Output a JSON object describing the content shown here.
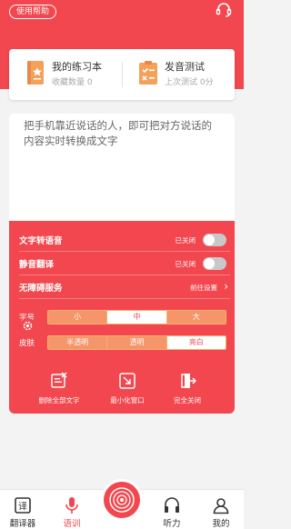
{
  "header": {
    "help_label": "使用帮助",
    "help_icon": "headset-icon"
  },
  "practice": {
    "notebook": {
      "title": "我的练习本",
      "subtitle": "收藏数量 0",
      "icon": "notebook-icon"
    },
    "test": {
      "title": "发音测试",
      "subtitle": "上次测试 0分",
      "icon": "checklist-icon"
    }
  },
  "input": {
    "hint": "把手机靠近说话的人，即可把对方说话的内容实时转换成文字"
  },
  "controls": {
    "tts": {
      "label": "文字转语音",
      "status": "已关闭",
      "on": false
    },
    "mute": {
      "label": "静音翻译",
      "status": "已关闭",
      "on": false
    },
    "accessibility": {
      "label": "无障碍服务",
      "link": "前往设置"
    },
    "font_size": {
      "label": "字号",
      "options": [
        "小",
        "中",
        "大"
      ],
      "selected": 1
    },
    "skin": {
      "label": "皮肤",
      "options": [
        "半透明",
        "透明",
        "亮白"
      ],
      "selected": 2
    },
    "actions": [
      {
        "label": "删除全部文字",
        "icon": "delete-text-icon"
      },
      {
        "label": "最小化窗口",
        "icon": "minimize-icon"
      },
      {
        "label": "完全关闭",
        "icon": "exit-icon"
      }
    ]
  },
  "colors": {
    "accent": "#f2474e",
    "segment": "#f4956a"
  },
  "nav": {
    "items": [
      {
        "label": "翻译器",
        "icon": "translator-icon"
      },
      {
        "label": "语训",
        "icon": "microphone-icon"
      },
      {
        "label": "听力",
        "icon": "headphones-icon"
      },
      {
        "label": "我的",
        "icon": "profile-icon"
      }
    ],
    "active": 1,
    "center_icon": "record-icon"
  }
}
